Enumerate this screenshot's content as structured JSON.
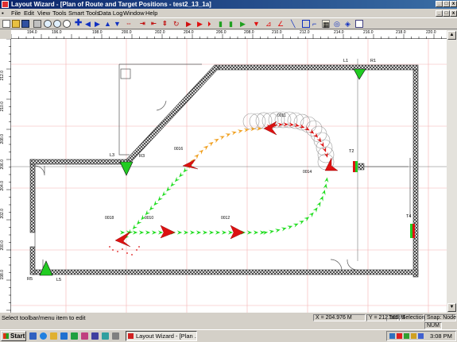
{
  "window": {
    "title": "Layout Wizard - [Plan of Route and Target Positions - test2_13_1a]",
    "buttons": [
      "minimize",
      "maximize",
      "close"
    ]
  },
  "menu": [
    "File",
    "Edit",
    "View",
    "Tools",
    "Smart Tools",
    "Data Log",
    "Window",
    "Help"
  ],
  "toolbar_icons": [
    "new-icon",
    "open-icon",
    "save-icon",
    "print-icon",
    "zoom-in-icon",
    "zoom-out-icon",
    "move-icon",
    "arrow-left-icon",
    "arrow-right-icon",
    "arrow-up-icon",
    "arrow-down-icon",
    "fit-icon",
    "shrink-icon",
    "flip-icon",
    "pan-icon",
    "play-icon",
    "step-icon",
    "record-icon",
    "stop-icon",
    "route-icon",
    "target-icon",
    "line-icon",
    "rect-icon",
    "circle-icon",
    "select-icon",
    "grid-icon",
    "node-icon",
    "info-icon"
  ],
  "ruler": {
    "x_labels": [
      "194.0",
      "196.0",
      "198.0",
      "200.0",
      "202.0",
      "204.0",
      "206.0",
      "208.0",
      "210.0",
      "212.0",
      "214.0",
      "216.0",
      "218.0",
      "220.0"
    ],
    "y_labels": [
      "212.0",
      "210.0",
      "208.0",
      "206.0",
      "204.0",
      "202.0",
      "200.0",
      "198.0"
    ]
  },
  "labels": {
    "l1": "L1",
    "r1": "R1",
    "l3": "L3",
    "r3": "R3",
    "r5": "R5",
    "l5": "L5",
    "t2": "T2",
    "t4": "T4",
    "n0011": "0011",
    "n0016": "0016",
    "n0014": "0014",
    "n0018": "0018",
    "n0010": "0010",
    "n0012": "0012"
  },
  "hint": "Select toolbar/menu item to edit",
  "status": {
    "x": "X = 204.976 M",
    "y": "Y = 212.565 M",
    "tool": "Tool: Selection",
    "snap": "Snap: Node",
    "num": "NUM"
  },
  "taskbar": {
    "start": "Start",
    "task": "Layout Wizard - [Plan ...",
    "clock": "3:08 PM"
  },
  "colors": {
    "route": "#22dd22",
    "route_orange": "#f0a020",
    "marker_red": "#dd1111",
    "marker_green": "#22cc22",
    "wall_hatch": "#333333"
  }
}
